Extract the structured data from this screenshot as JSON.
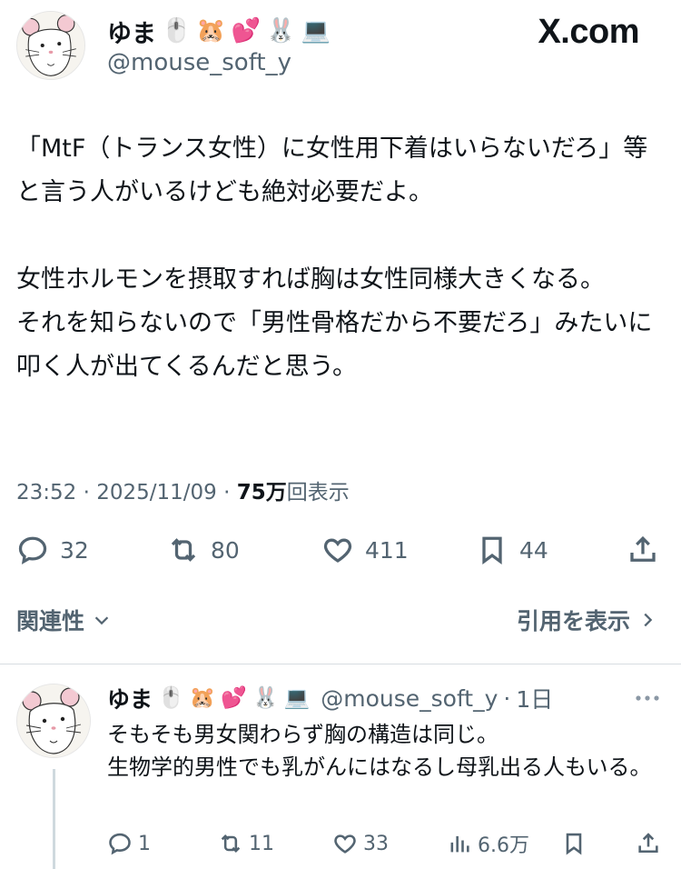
{
  "tweet": {
    "display_name": "ゆま",
    "name_emojis": [
      "🖱️",
      "🐹",
      "💕",
      "🐰",
      "💻"
    ],
    "handle": "@mouse_soft_y",
    "site_label": "X.com",
    "body": "「MtF（トランス女性）に女性用下着はいらないだろ」等と言う人がいるけども絶対必要だよ。\n\n女性ホルモンを摂取すれば胸は女性同様大きくなる。\nそれを知らないので「男性骨格だから不要だろ」みたいに叩く人が出てくるんだと思う。",
    "time": "23:52",
    "date": "2025/11/09",
    "views_count": "75万",
    "views_label": "回表示",
    "separator": "·",
    "stats": {
      "replies": "32",
      "retweets": "80",
      "likes": "411",
      "bookmarks": "44"
    },
    "related_label": "関連性",
    "quotes_label": "引用を表示"
  },
  "reply": {
    "display_name": "ゆま",
    "name_emojis": [
      "🖱️",
      "🐹",
      "💕",
      "🐰",
      "💻"
    ],
    "handle": "@mouse_soft_y",
    "age": "1日",
    "body": "そもそも男女関わらず胸の構造は同じ。\n生物学的男性でも乳がんにはなるし母乳出る人もいる。",
    "stats": {
      "replies": "1",
      "retweets": "11",
      "likes": "33",
      "views": "6.6万"
    }
  },
  "icons": {
    "reply": "speech-bubble-icon",
    "retweet": "retweet-arrows-icon",
    "like": "heart-icon",
    "bookmark": "bookmark-icon",
    "share": "share-upload-icon",
    "views": "bar-chart-icon",
    "more": "more-dots-icon",
    "chevron_down": "chevron-down-icon",
    "chevron_right": "chevron-right-icon"
  },
  "colors": {
    "text": "#0f1419",
    "secondary": "#536471",
    "divider": "#d8dde1"
  }
}
